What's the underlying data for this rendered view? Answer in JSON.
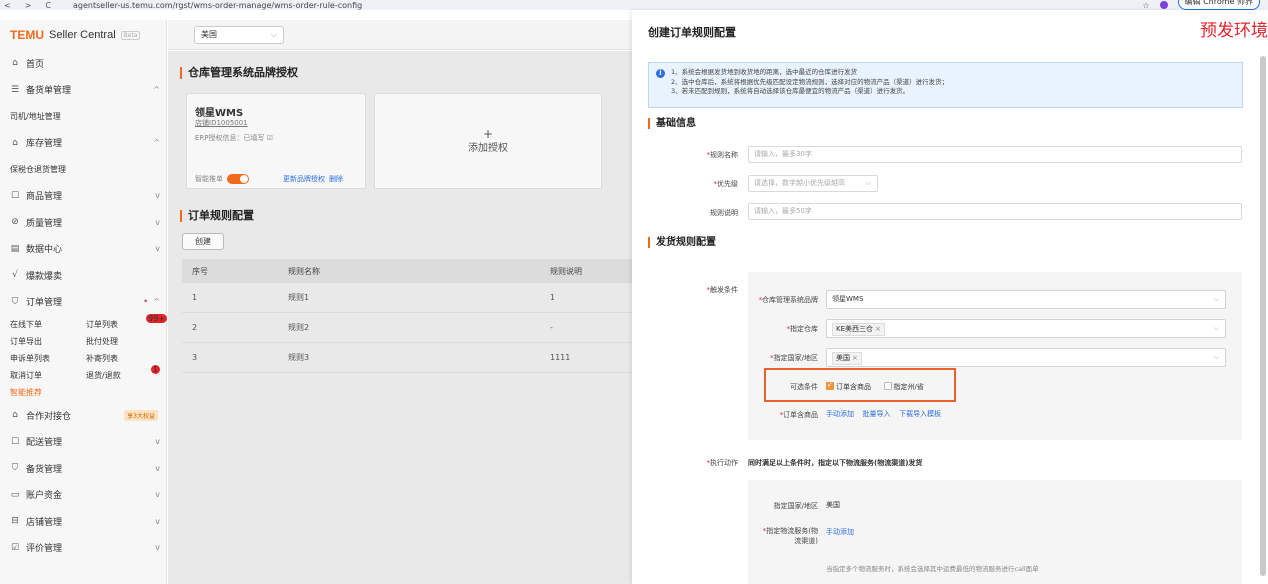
{
  "browser": {
    "nav_back": "<",
    "nav_forward": ">",
    "nav_reload": "C",
    "url": "agentseller-us.temu.com/rgst/wms-order-manage/wms-order-rule-config",
    "chrome_button": "编辑 Chrome 师界"
  },
  "sidebar": {
    "logo": "TEMU",
    "logo_sub": "Seller Central",
    "beta": "Beta",
    "items": [
      {
        "icon": "home-icon",
        "glyph": "⌂",
        "label": "首页"
      },
      {
        "icon": "stock-icon",
        "glyph": "☰",
        "label": "备货单管理",
        "chev": "^"
      },
      {
        "sub": "司机/地址管理"
      },
      {
        "icon": "warehouse-icon",
        "glyph": "⌂",
        "label": "库存管理",
        "chev": "^"
      },
      {
        "sub": "保税仓退货管理"
      },
      {
        "icon": "goods-icon",
        "glyph": "☐",
        "label": "商品管理",
        "chev": "v"
      },
      {
        "icon": "quality-icon",
        "glyph": "⊘",
        "label": "质量管理",
        "chev": "v"
      },
      {
        "icon": "data-icon",
        "glyph": "▤",
        "label": "数据中心",
        "chev": "v"
      },
      {
        "icon": "promo-icon",
        "glyph": "√",
        "label": "爆款爆卖"
      },
      {
        "icon": "order-icon",
        "glyph": "⛉",
        "label": "订单管理",
        "chev": "^"
      }
    ],
    "order_sub": [
      [
        "在线下单",
        "订单列表"
      ],
      [
        "订单导出",
        "批付处理"
      ],
      [
        "申诉单列表",
        "补寄列表"
      ],
      [
        "取消订单",
        "退货/退款"
      ],
      [
        "智能推荐",
        ""
      ]
    ],
    "order_badge": "99+",
    "refund_badge": "1",
    "bottom_items": [
      {
        "icon": "coop-icon",
        "glyph": "⌂",
        "label": "合作对接仓",
        "tag": "享3大权益"
      },
      {
        "icon": "delivery-icon",
        "glyph": "☐",
        "label": "配送管理",
        "chev": "v"
      },
      {
        "icon": "aftersale-icon",
        "glyph": "⛉",
        "label": "备货管理",
        "chev": "v"
      },
      {
        "icon": "account-icon",
        "glyph": "▭",
        "label": "账户资金",
        "chev": "v"
      },
      {
        "icon": "shop-icon",
        "glyph": "⊟",
        "label": "店铺管理",
        "chev": "v"
      },
      {
        "icon": "review-icon",
        "glyph": "☑",
        "label": "评价管理",
        "chev": "v"
      }
    ]
  },
  "header": {
    "region": "美国"
  },
  "main": {
    "warehouse_title": "仓库管理系统品牌授权",
    "wms_card": {
      "title": "领星WMS",
      "id": "店铺ID1005001",
      "erp": "ERP授权信息：已填写 ☑",
      "toggle_label": "智能推单",
      "link_update": "更新品牌授权",
      "link_delete": "删除"
    },
    "add_label": "添加授权",
    "rule_title": "订单规则配置",
    "create_btn": "创建",
    "table": {
      "headers": [
        "序号",
        "规则名称",
        "规则说明"
      ],
      "rows": [
        [
          "1",
          "规则1",
          "1"
        ],
        [
          "2",
          "规则2",
          "-"
        ],
        [
          "3",
          "规则3",
          "1111"
        ]
      ]
    }
  },
  "drawer": {
    "title": "创建订单规则配置",
    "env": "预发环境",
    "info_lines": [
      "1、系统会根据发货地到收货地的距离，选中最近的仓库进行发货",
      "2、选中仓库后，系统将根据优先级匹配设定物流规则，选择对应的物流产品（渠道）进行发货；",
      "3、若未匹配到规则，系统将自动选择该仓库最便宜的物流产品（渠道）进行发货。"
    ],
    "basic_title": "基础信息",
    "rule_name_label": "规则名称",
    "rule_name_placeholder": "请输入，最多30字",
    "priority_label": "优先级",
    "priority_placeholder": "请选择，数字越小优先级越高",
    "rule_desc_label": "规则说明",
    "rule_desc_placeholder": "请输入，最多50字",
    "ship_title": "发货规则配置",
    "trigger_label": "触发条件",
    "wms_brand_label": "仓库管理系统品牌",
    "wms_brand_value": "领星WMS",
    "warehouse_label": "指定仓库",
    "warehouse_chip": "KE美西三仓",
    "country_label": "指定国家/地区",
    "country_chip": "美国",
    "optional_label": "可选条件",
    "opt1": "订单含商品",
    "opt2": "指定州/省",
    "goods_label": "订单含商品",
    "goods_link1": "手动添加",
    "goods_link2": "批量导入",
    "goods_link3": "下载导入模板",
    "action_label": "执行动作",
    "action_text": "同时满足以上条件时，指定以下物流服务(物流渠道)发货",
    "action_country_label": "指定国家/地区",
    "action_country_value": "美国",
    "logistics_label_1": "指定物流服务(物",
    "logistics_label_2": "流渠道)",
    "logistics_link": "手动添加",
    "logistics_hint": "当指定多个物流服务时，系统会选择其中运费最低的物流服务进行call面单"
  }
}
